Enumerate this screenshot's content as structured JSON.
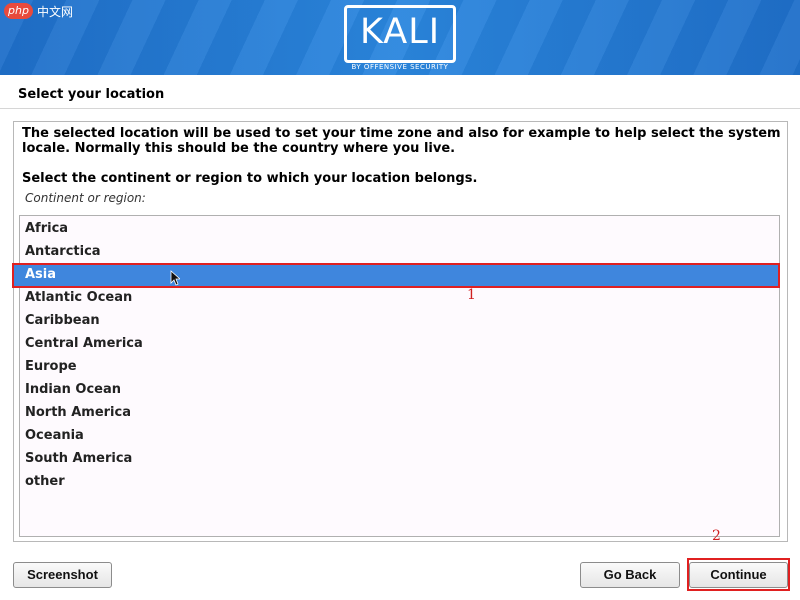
{
  "watermark": {
    "badge": "php",
    "text": "中文网"
  },
  "header": {
    "logo_text": "KALI",
    "logo_sub": "BY OFFENSIVE SECURITY"
  },
  "page": {
    "title": "Select your location"
  },
  "panel": {
    "description": "The selected location will be used to set your time zone and also for example to help select the system locale. Normally this should be the country where you live.",
    "instruction": "Select the continent or region to which your location belongs.",
    "field_label": "Continent or region:"
  },
  "regions": {
    "items": [
      "Africa",
      "Antarctica",
      "Asia",
      "Atlantic Ocean",
      "Caribbean",
      "Central America",
      "Europe",
      "Indian Ocean",
      "North America",
      "Oceania",
      "South America",
      "other"
    ],
    "selected": "Asia"
  },
  "annotations": {
    "first": "1",
    "second": "2"
  },
  "buttons": {
    "screenshot": "Screenshot",
    "go_back": "Go Back",
    "continue": "Continue"
  },
  "colors": {
    "banner": "#2a86de",
    "selection": "#3f86dd",
    "annotation": "#e02020"
  }
}
